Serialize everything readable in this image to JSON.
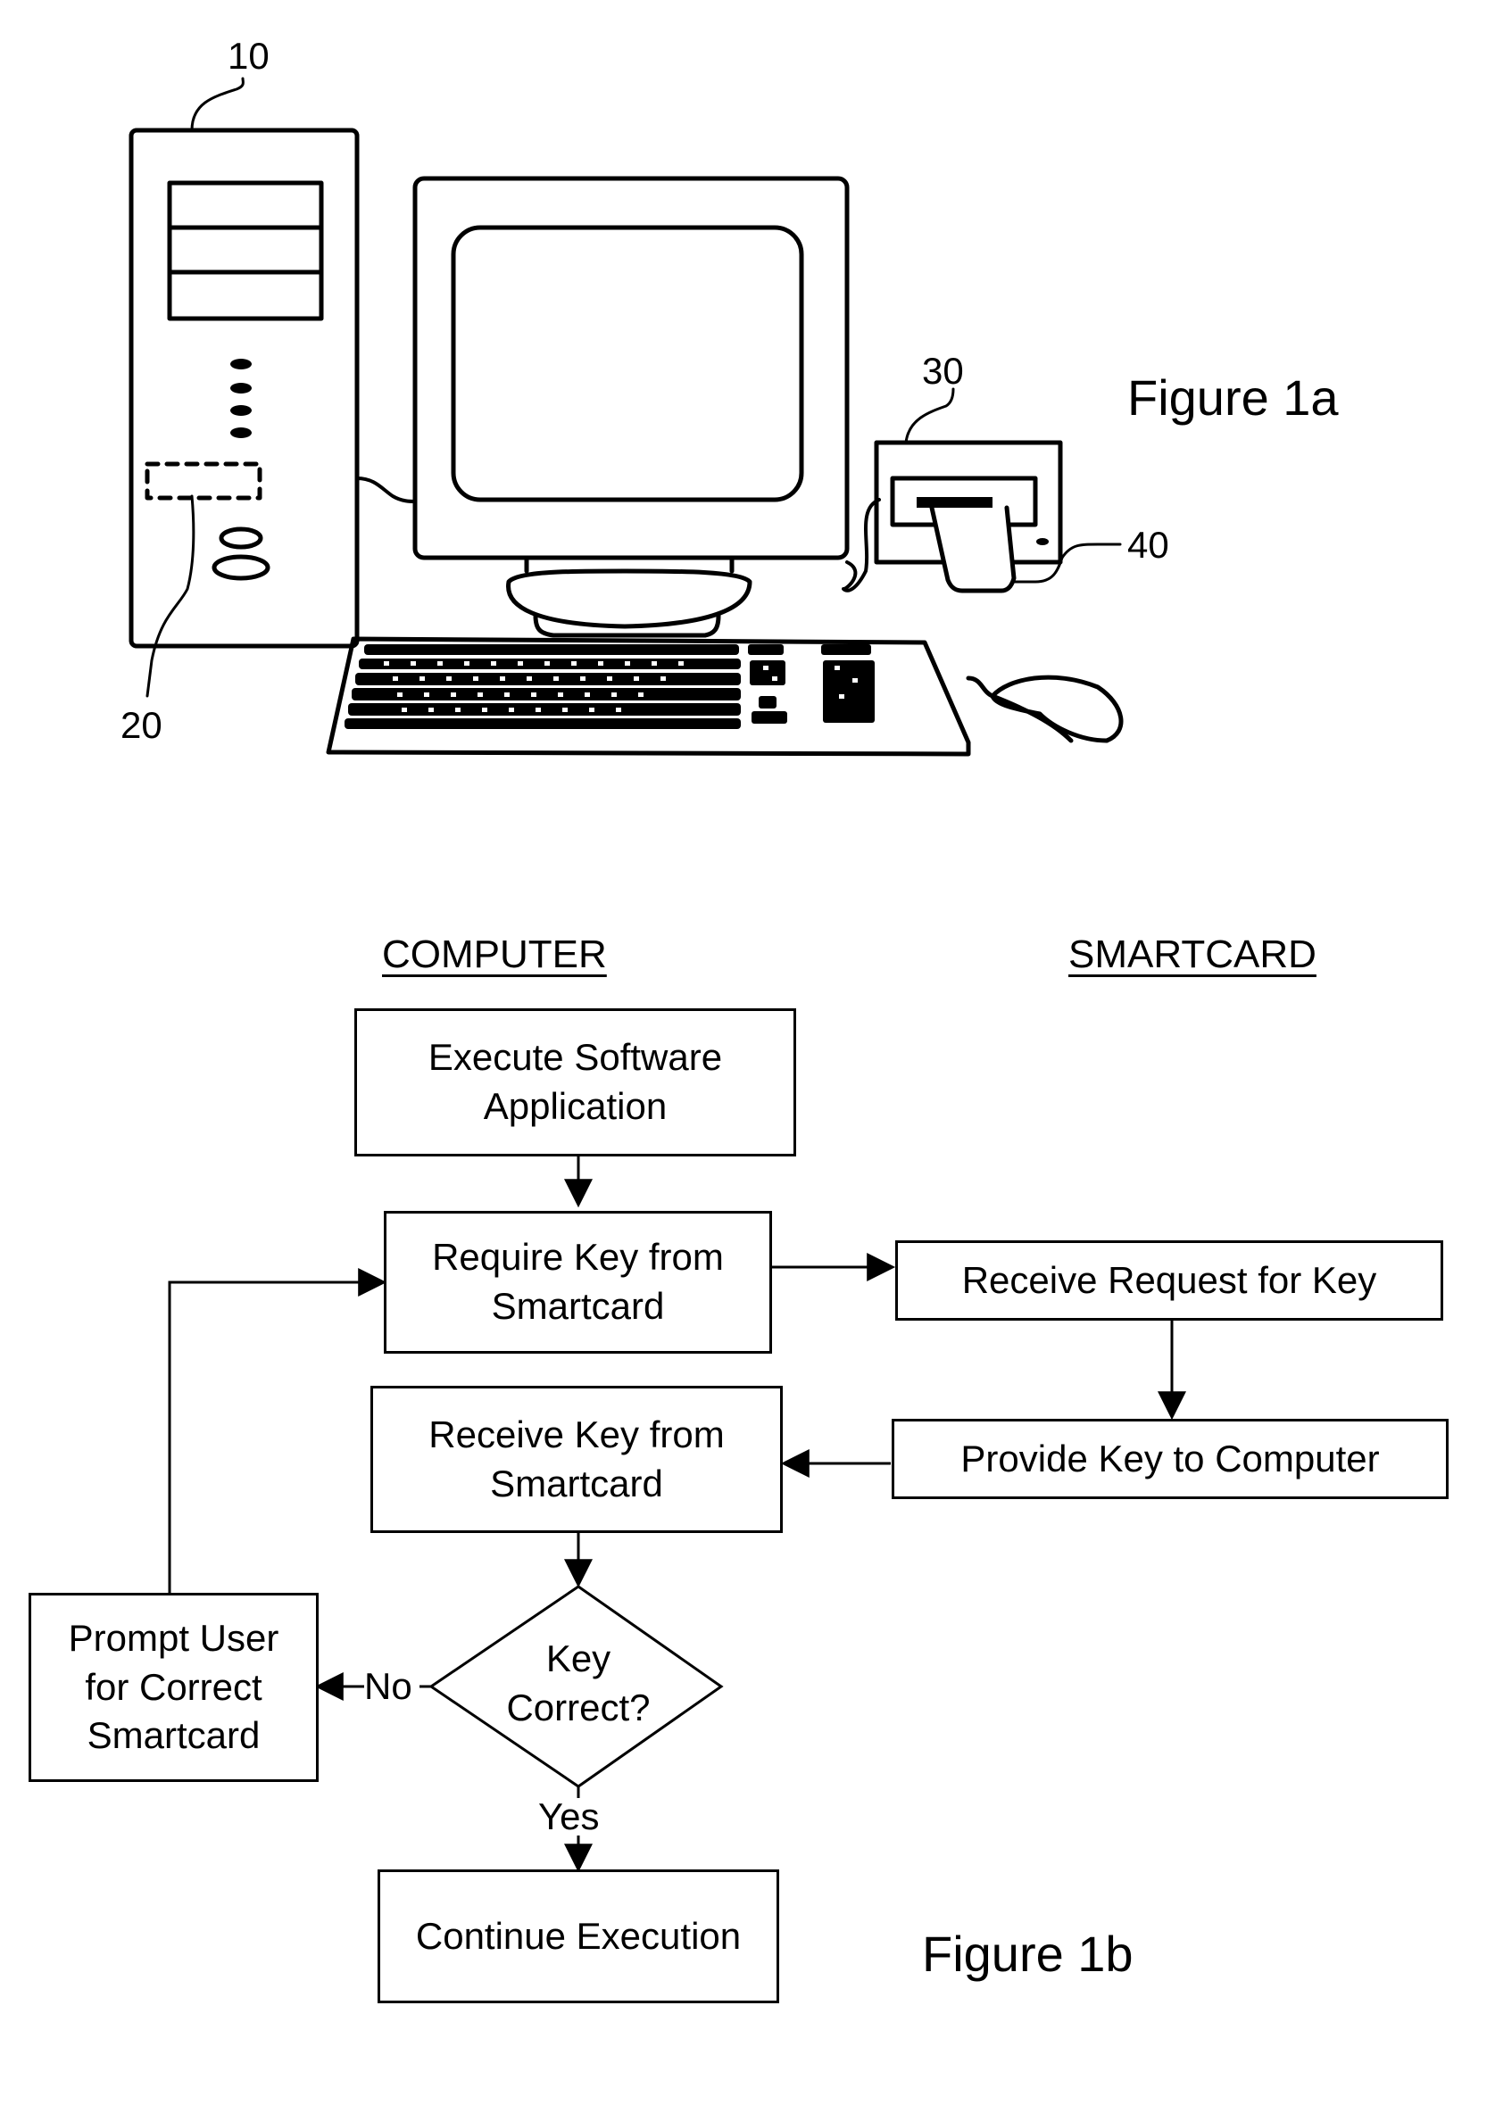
{
  "figure_1a": {
    "title": "Figure 1a",
    "reference_numerals": {
      "computer_tower": "10",
      "internal_component": "20",
      "card_reader": "30",
      "smartcard": "40"
    }
  },
  "figure_1b": {
    "title": "Figure 1b",
    "lanes": {
      "computer": "COMPUTER",
      "smartcard": "SMARTCARD"
    },
    "steps": {
      "execute": [
        "Execute Software",
        "Application"
      ],
      "require_key": [
        "Require Key from",
        "Smartcard"
      ],
      "receive_request": [
        "Receive Request for Key"
      ],
      "provide_key": [
        "Provide Key to Computer"
      ],
      "receive_key": [
        "Receive Key from",
        "Smartcard"
      ],
      "decision": [
        "Key",
        "Correct?"
      ],
      "prompt_user": [
        "Prompt User",
        "for Correct",
        "Smartcard"
      ],
      "continue": [
        "Continue Execution"
      ]
    },
    "branches": {
      "no": "No",
      "yes": "Yes"
    }
  }
}
